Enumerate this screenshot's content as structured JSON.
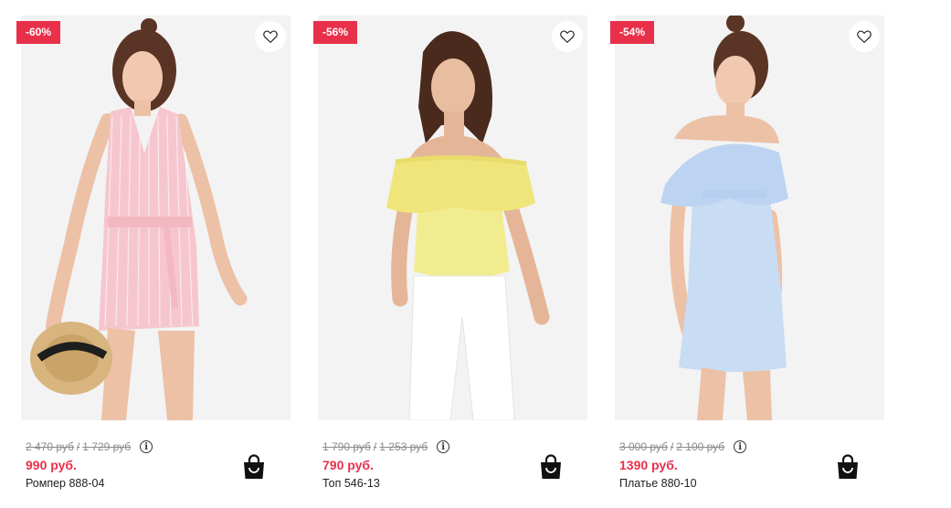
{
  "products": [
    {
      "discount": "-60%",
      "old_price_1": "2 470 руб",
      "old_price_2": "1 729 руб",
      "price": "990 руб.",
      "name": "Ромпер 888-04",
      "garment_color": "#f6c6cf"
    },
    {
      "discount": "-56%",
      "old_price_1": "1 790 руб",
      "old_price_2": "1 253 руб",
      "price": "790 руб.",
      "name": "Топ 546-13",
      "garment_color": "#f2ec90"
    },
    {
      "discount": "-54%",
      "old_price_1": "3 000 руб",
      "old_price_2": "2 100 руб",
      "price": "1390 руб.",
      "name": "Платье 880-10",
      "garment_color": "#c8dcf4"
    }
  ],
  "separator": "/",
  "info_glyph": "i",
  "colors": {
    "accent": "#e8304a",
    "old_price": "#8a8a8a",
    "photo_bg": "#f3f3f4"
  },
  "icons": {
    "wishlist": "heart-outline-icon",
    "info": "info-circle-icon",
    "cart": "shopping-bag-icon"
  }
}
